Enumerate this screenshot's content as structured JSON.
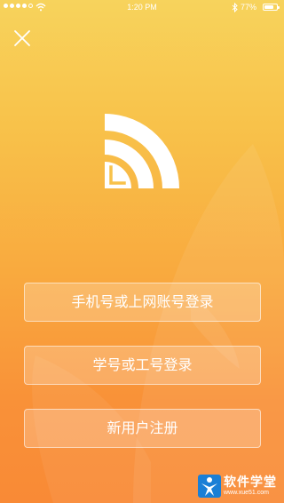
{
  "status_bar": {
    "time": "1:20 PM",
    "battery_percent": "77%",
    "battery_level": 0.77,
    "signal_bars_filled": 4,
    "signal_bars_total": 5
  },
  "icons": {
    "close": "close-icon",
    "logo": "wifi-corner-logo-icon",
    "wifi": "wifi-icon",
    "bluetooth": "bluetooth-icon",
    "battery": "battery-icon"
  },
  "buttons": {
    "phone_login": "手机号或上网账号登录",
    "student_login": "学号或工号登录",
    "register": "新用户注册"
  },
  "watermark": {
    "title": "软件学堂",
    "url": "www.xue51.com"
  },
  "colors": {
    "gradient_top": "#f7d35c",
    "gradient_bottom": "#f98a36",
    "text": "#ffffff"
  }
}
